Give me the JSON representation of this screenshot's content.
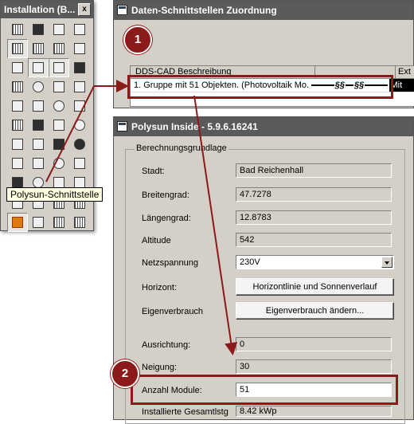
{
  "toolbar": {
    "title": "Installation (B...",
    "close_label": "x",
    "tooltip": "Polysun-Schnittstelle"
  },
  "data_interface_window": {
    "title": "Daten-Schnittstellen Zuordnung",
    "columns": [
      "DDS-CAD Beschreibung",
      "",
      "Ext"
    ],
    "rows": [
      {
        "description": "1. Gruppe mit 51 Objekten. (Photovoltaik Mo...",
        "marks": [
          "§§",
          "§§"
        ],
        "ext": "Mit"
      }
    ]
  },
  "polysun_window": {
    "title": "Polysun Inside - 5.9.6.16241",
    "group_title": "Berechnungsgrundlage",
    "fields": {
      "stadt": {
        "label": "Stadt:",
        "value": "Bad Reichenhall"
      },
      "breitengrad": {
        "label": "Breitengrad:",
        "value": "47.7278"
      },
      "laengengrad": {
        "label": "Längengrad:",
        "value": "12.8783"
      },
      "altitude": {
        "label": "Altitude",
        "value": "542"
      },
      "netzspannung": {
        "label": "Netzspannung",
        "value": "230V"
      },
      "horizont": {
        "label": "Horizont:",
        "button": "Horizontlinie und Sonnenverlauf"
      },
      "eigenverbrauch": {
        "label": "Eigenverbrauch",
        "button": "Eigenverbrauch ändern..."
      },
      "ausrichtung": {
        "label": "Ausrichtung:",
        "value": "0"
      },
      "neigung": {
        "label": "Neigung:",
        "value": "30"
      },
      "anzahl_module": {
        "label": "Anzahl Module:",
        "value": "51"
      },
      "installierte": {
        "label": "Installierte Gesamtlstg",
        "value": "8.42 kWp"
      }
    }
  },
  "callouts": [
    "1",
    "2"
  ],
  "colors": {
    "accent": "#8b1a1a",
    "titlebar": "#5a5a5a",
    "window_bg": "#d4d0c8"
  }
}
